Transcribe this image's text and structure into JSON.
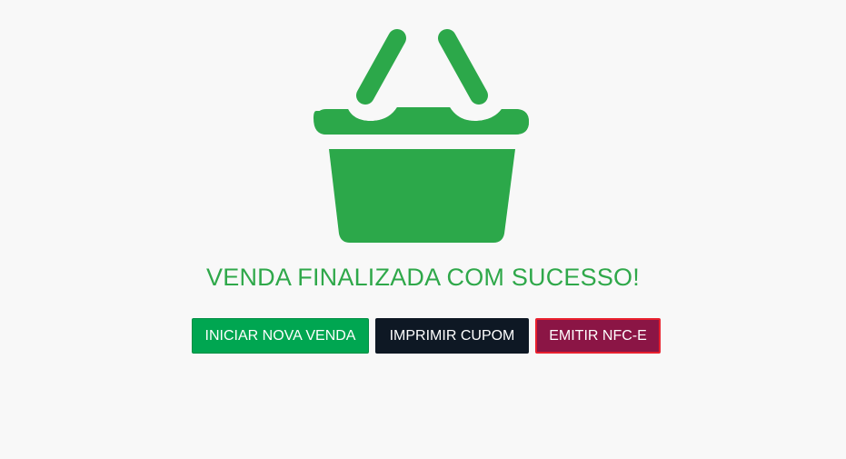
{
  "icon": {
    "name": "shopping-basket-icon",
    "color": "#2ca84a"
  },
  "message": "VENDA FINALIZADA COM SUCESSO!",
  "actions": {
    "new_sale": "INICIAR NOVA VENDA",
    "print_receipt": "IMPRIMIR CUPOM",
    "emit_nfce": "EMITIR NFC-E"
  },
  "colors": {
    "success_text": "#2fa84a",
    "new_sale_bg": "#00a651",
    "print_bg": "#0e1824",
    "nfce_bg": "#8b1545",
    "nfce_border": "#e8202e"
  }
}
